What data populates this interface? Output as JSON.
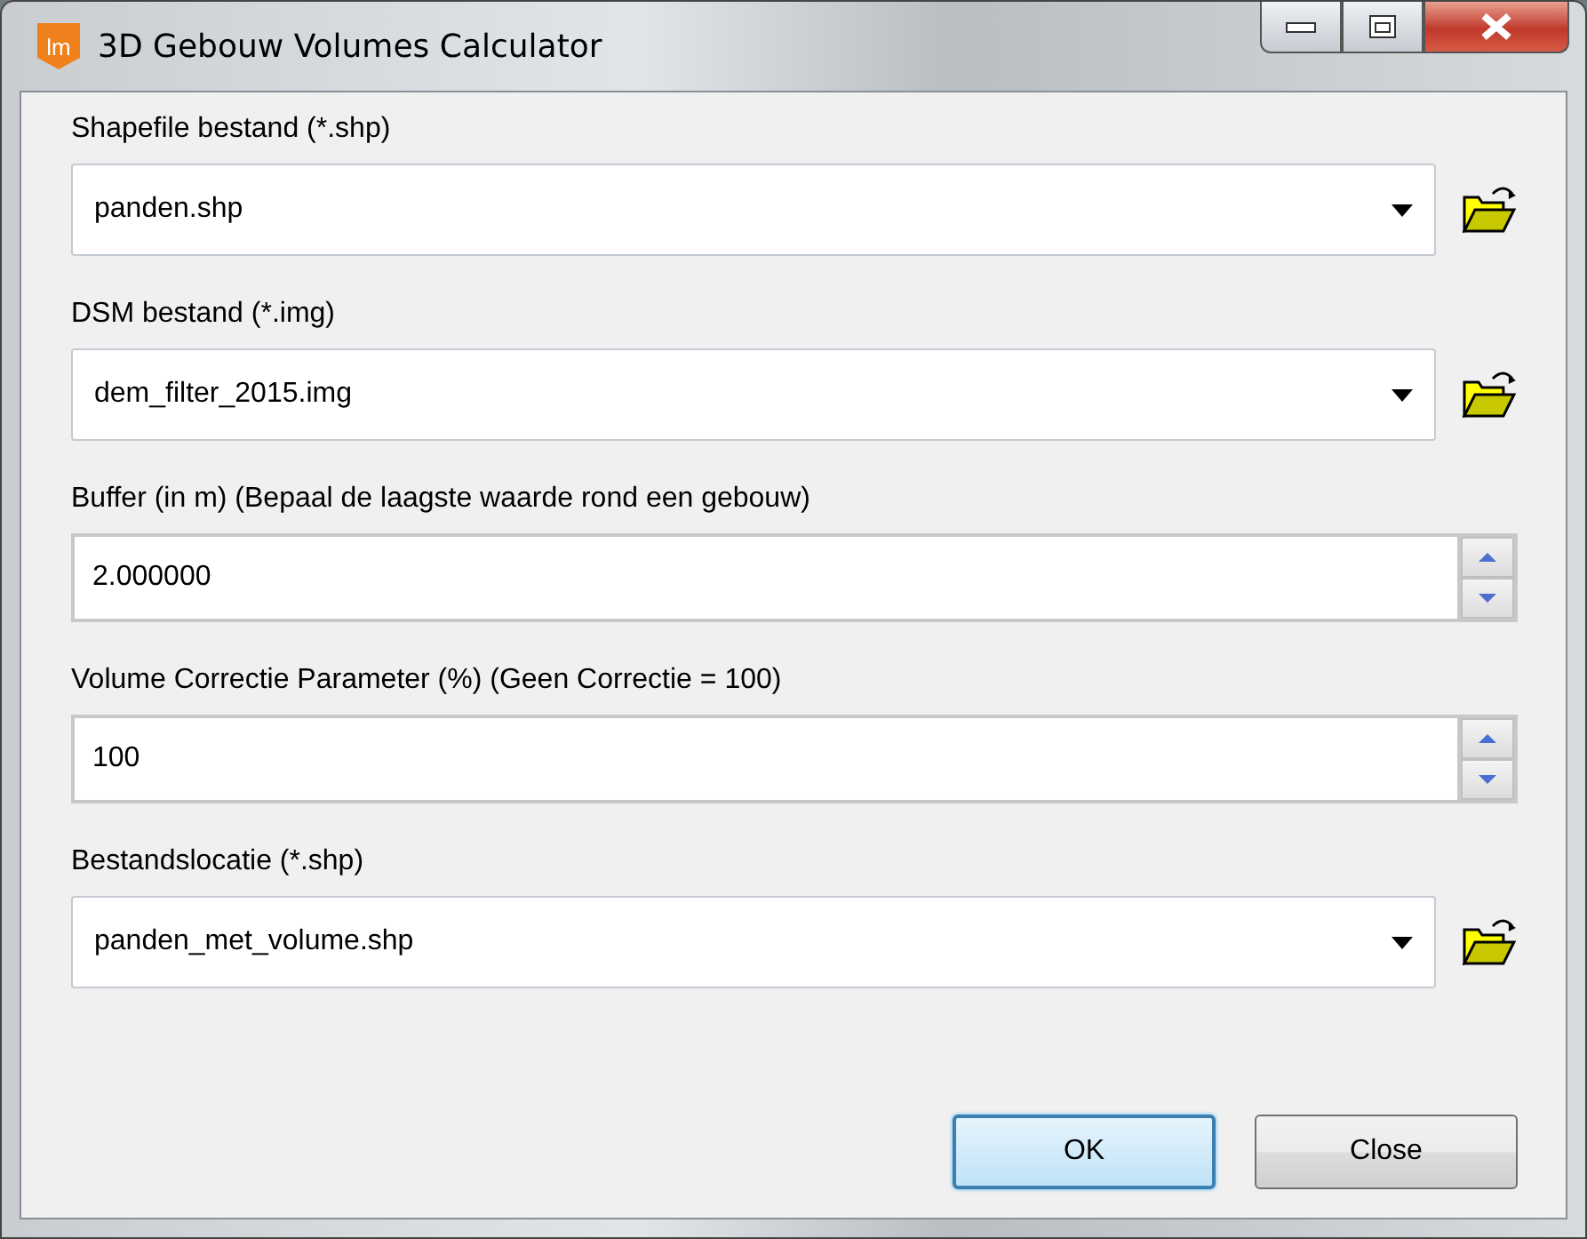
{
  "window": {
    "app_icon": "lm",
    "title": "3D Gebouw Volumes Calculator"
  },
  "fields": [
    {
      "kind": "combo",
      "label": "Shapefile bestand (*.shp)",
      "value": "panden.shp"
    },
    {
      "kind": "combo",
      "label": "DSM bestand (*.img)",
      "value": "dem_filter_2015.img"
    },
    {
      "kind": "spin",
      "label": "Buffer (in m) (Bepaal de laagste waarde rond een gebouw)",
      "value": "2.000000"
    },
    {
      "kind": "spin",
      "label": "Volume Correctie Parameter (%) (Geen Correctie = 100)",
      "value": "100"
    },
    {
      "kind": "combo",
      "label": "Bestandslocatie (*.shp)",
      "value": "panden_met_volume.shp"
    }
  ],
  "buttons": [
    {
      "label": "OK",
      "default": true
    },
    {
      "label": "Close",
      "default": false
    }
  ]
}
